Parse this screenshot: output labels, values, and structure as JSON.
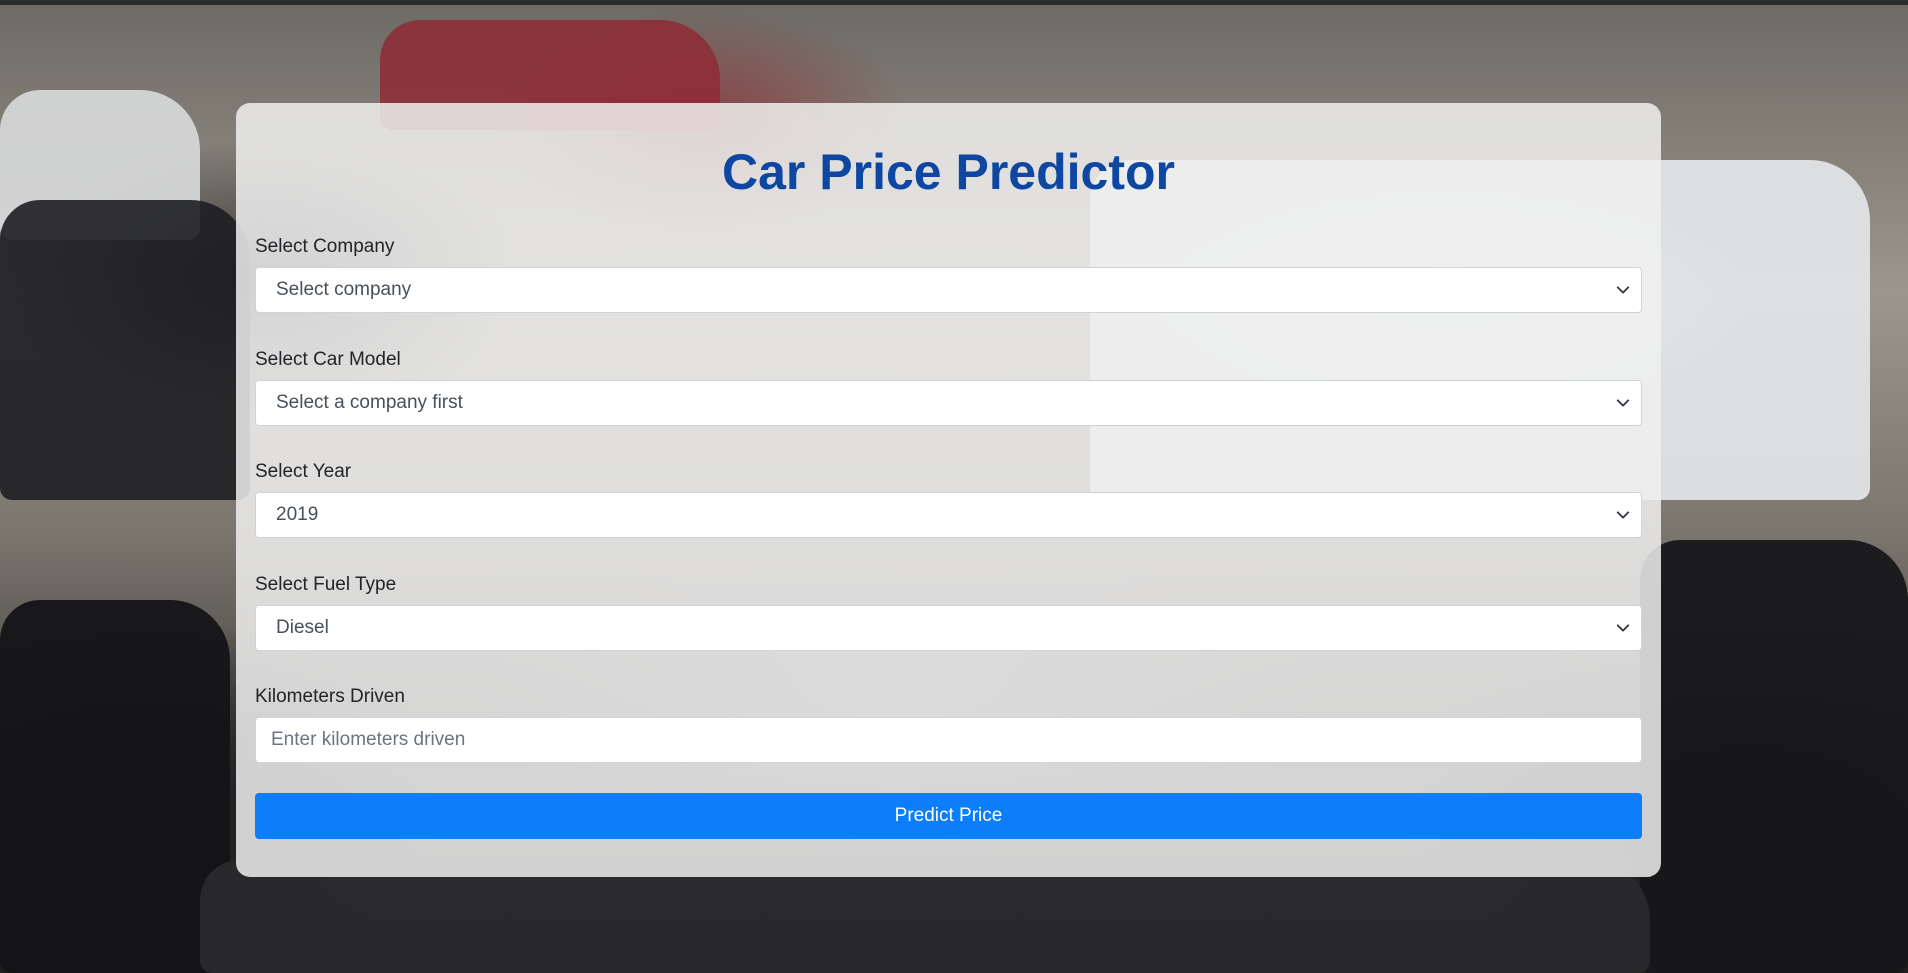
{
  "app": {
    "title": "Car Price Predictor"
  },
  "form": {
    "company": {
      "label": "Select Company",
      "selected": "Select company"
    },
    "car_model": {
      "label": "Select Car Model",
      "selected": "Select a company first"
    },
    "year": {
      "label": "Select Year",
      "selected": "2019"
    },
    "fuel_type": {
      "label": "Select Fuel Type",
      "selected": "Diesel"
    },
    "kilometers": {
      "label": "Kilometers Driven",
      "placeholder": "Enter kilometers driven",
      "value": ""
    },
    "submit_label": "Predict Price"
  },
  "colors": {
    "title": "#0d47a1",
    "button": "#0d7ef9",
    "card_background": "rgba(240,240,240,0.85)"
  },
  "icons": {
    "dropdown": "chevron-down-icon"
  }
}
